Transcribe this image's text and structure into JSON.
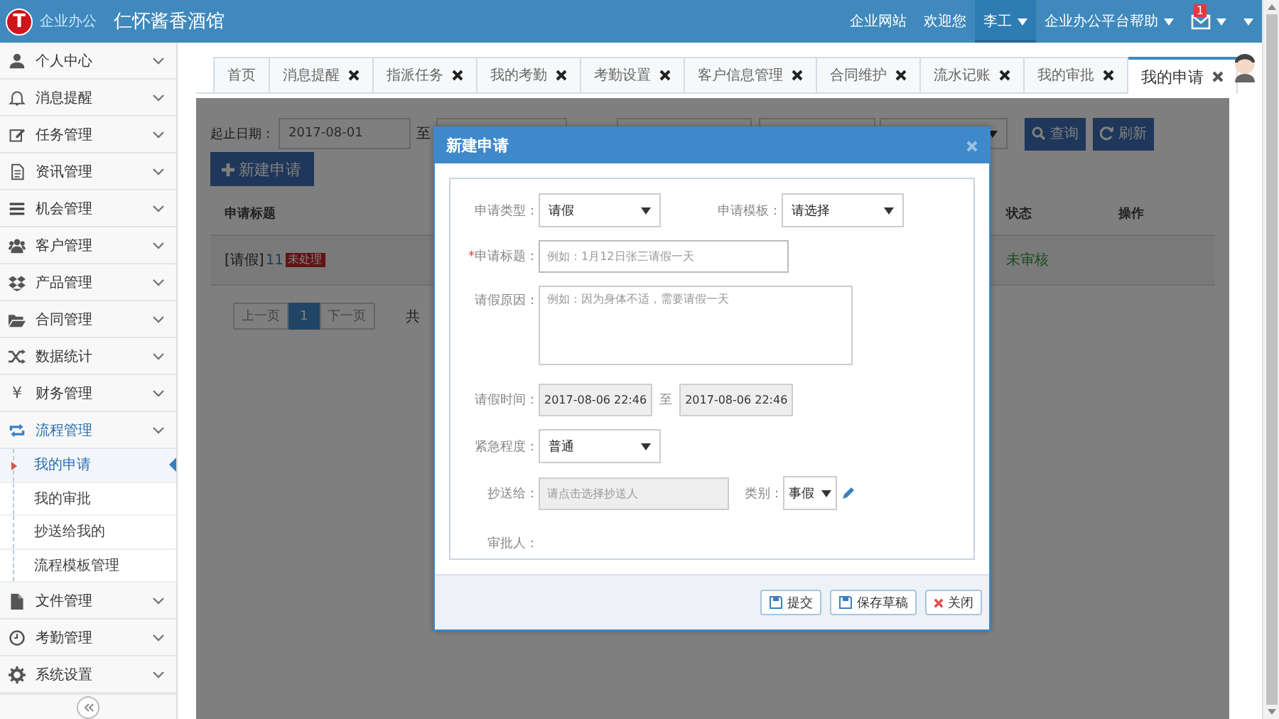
{
  "header": {
    "logo_letter": "T",
    "logo_text": "企业办公",
    "title": "仁怀酱香酒馆",
    "nav": [
      {
        "label": "企业网站",
        "dropdown": false,
        "selected": false
      },
      {
        "label": "欢迎您",
        "dropdown": false,
        "selected": false
      },
      {
        "label": "李工",
        "dropdown": true,
        "selected": true
      },
      {
        "label": "企业办公平台帮助",
        "dropdown": true,
        "selected": false
      }
    ],
    "mail_badge": "1"
  },
  "sidebar": {
    "items": [
      {
        "label": "个人中心",
        "expanded": false
      },
      {
        "label": "消息提醒",
        "expanded": false
      },
      {
        "label": "任务管理",
        "expanded": false
      },
      {
        "label": "资讯管理",
        "expanded": false
      },
      {
        "label": "机会管理",
        "expanded": false
      },
      {
        "label": "客户管理",
        "expanded": false
      },
      {
        "label": "产品管理",
        "expanded": false
      },
      {
        "label": "合同管理",
        "expanded": false
      },
      {
        "label": "数据统计",
        "expanded": false
      },
      {
        "label": "财务管理",
        "expanded": false,
        "glyph": "¥"
      },
      {
        "label": "流程管理",
        "expanded": true,
        "children": [
          {
            "label": "我的申请",
            "selected": true
          },
          {
            "label": "我的审批",
            "selected": false
          },
          {
            "label": "抄送给我的",
            "selected": false
          },
          {
            "label": "流程模板管理",
            "selected": false
          }
        ]
      },
      {
        "label": "文件管理",
        "expanded": false
      },
      {
        "label": "考勤管理",
        "expanded": false
      },
      {
        "label": "系统设置",
        "expanded": false
      }
    ]
  },
  "tabs": [
    {
      "label": "首页",
      "closable": false,
      "selected": false
    },
    {
      "label": "消息提醒",
      "closable": true,
      "selected": false
    },
    {
      "label": "指派任务",
      "closable": true,
      "selected": false
    },
    {
      "label": "我的考勤",
      "closable": true,
      "selected": false
    },
    {
      "label": "考勤设置",
      "closable": true,
      "selected": false
    },
    {
      "label": "客户信息管理",
      "closable": true,
      "selected": false
    },
    {
      "label": "合同维护",
      "closable": true,
      "selected": false
    },
    {
      "label": "流水记账",
      "closable": true,
      "selected": false
    },
    {
      "label": "我的审批",
      "closable": true,
      "selected": false
    },
    {
      "label": "我的申请",
      "closable": true,
      "selected": true
    }
  ],
  "filter": {
    "label": "起止日期：",
    "start_date": "2017-08-01",
    "separator": "至",
    "buttons": [
      "查询",
      "刷新"
    ]
  },
  "new_button": "新建申请",
  "table": {
    "columns": [
      "申请标题",
      "状态",
      "操作"
    ],
    "rows": [
      {
        "type": "[请假]",
        "title": "11",
        "badge": "未处理",
        "status": "未审核"
      }
    ]
  },
  "pagination": {
    "prev": "上一页",
    "pages": [
      {
        "label": "1",
        "selected": true
      }
    ],
    "next": "下一页",
    "total_prefix": "共"
  },
  "dialog": {
    "title": "新建申请",
    "type_label": "申请类型：",
    "type_value": "请假",
    "template_label": "申请模板：",
    "template_value": "请选择",
    "title_mark": "*",
    "title_label": "申请标题：",
    "title_placeholder": "例如：1月12日张三请假一天",
    "reason_label": "请假原因：",
    "reason_placeholder": "例如：因为身体不适，需要请假一天",
    "time_label": "请假时间：",
    "time_start": "2017-08-06 22:46",
    "time_separator": "至",
    "time_end": "2017-08-06 22:46",
    "urgency_label": "紧急程度：",
    "urgency_value": "普通",
    "cc_label": "抄送给：",
    "cc_placeholder": "请点击选择抄送人",
    "category_label": "类别：",
    "category_value": "事假",
    "approver_label": "审批人：",
    "buttons": [
      {
        "kind": "save",
        "label": "提交"
      },
      {
        "kind": "save",
        "label": "保存草稿"
      },
      {
        "kind": "close",
        "label": "关闭"
      }
    ]
  }
}
